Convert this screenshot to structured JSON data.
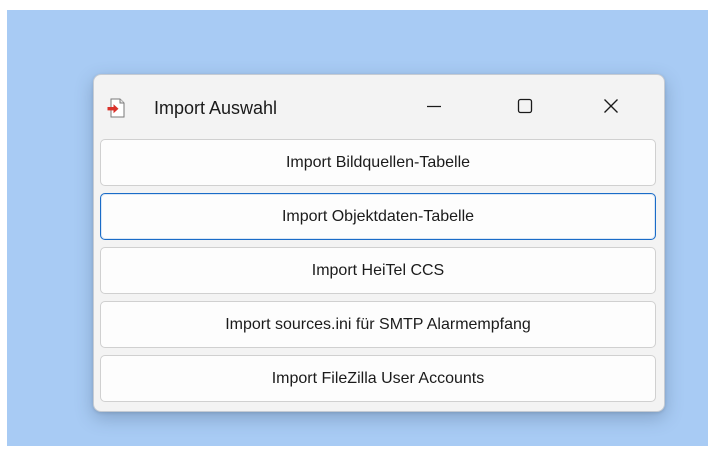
{
  "window": {
    "title": "Import Auswahl",
    "icon": "import-arrow-icon",
    "controls": {
      "minimize_icon": "minimize-icon",
      "maximize_icon": "maximize-icon",
      "close_icon": "close-icon"
    }
  },
  "buttons": [
    {
      "label": "Import Bildquellen-Tabelle",
      "focused": false
    },
    {
      "label": "Import Objektdaten-Tabelle",
      "focused": true
    },
    {
      "label": "Import HeiTel CCS",
      "focused": false
    },
    {
      "label": "Import sources.ini für SMTP Alarmempfang",
      "focused": false
    },
    {
      "label": "Import FileZilla User Accounts",
      "focused": false
    }
  ],
  "colors": {
    "desktop": "#a8cbf4",
    "window_bg": "#f3f3f3",
    "focus_border": "#1a6cc8",
    "icon_red": "#d9322b"
  }
}
